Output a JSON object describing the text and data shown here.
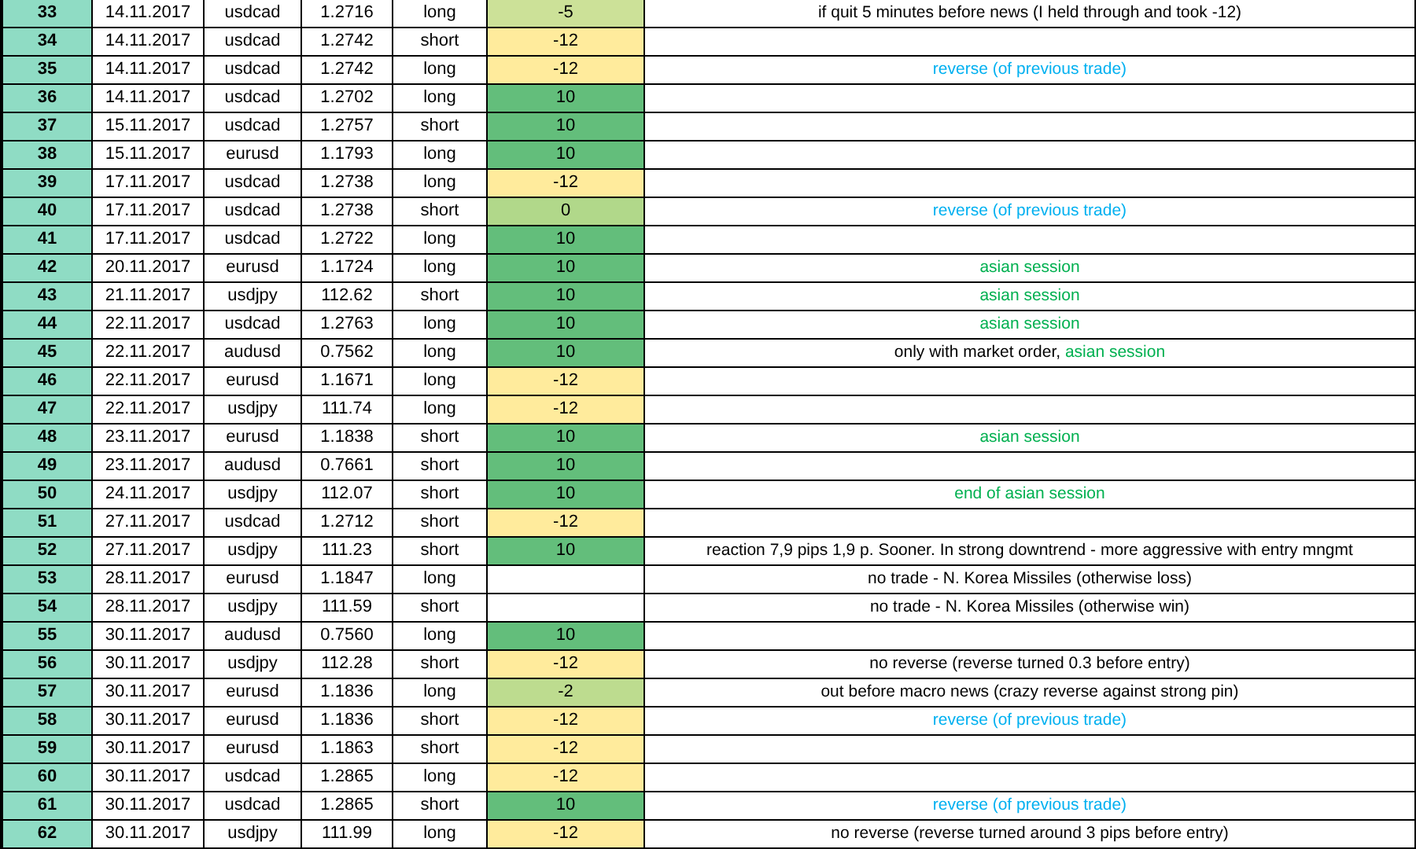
{
  "rows": [
    {
      "num": "33",
      "date": "14.11.2017",
      "pair": "usdcad",
      "price": "1.2716",
      "direction": "long",
      "result": {
        "text": "-5",
        "color": "#cce198"
      },
      "comment": [
        {
          "text": "if quit 5 minutes before news (I held through and took -12)",
          "color": "#000000"
        }
      ]
    },
    {
      "num": "34",
      "date": "14.11.2017",
      "pair": "usdcad",
      "price": "1.2742",
      "direction": "short",
      "result": {
        "text": "-12",
        "color": "#ffeb9c"
      }
    },
    {
      "num": "35",
      "date": "14.11.2017",
      "pair": "usdcad",
      "price": "1.2742",
      "direction": "long",
      "result": {
        "text": "-12",
        "color": "#ffeb9c"
      },
      "comment": [
        {
          "text": "reverse (of previous trade)",
          "color": "#00b0f0"
        }
      ]
    },
    {
      "num": "36",
      "date": "14.11.2017",
      "pair": "usdcad",
      "price": "1.2702",
      "direction": "long",
      "result": {
        "text": "10",
        "color": "#63be7b"
      }
    },
    {
      "num": "37",
      "date": "15.11.2017",
      "pair": "usdcad",
      "price": "1.2757",
      "direction": "short",
      "result": {
        "text": "10",
        "color": "#63be7b"
      }
    },
    {
      "num": "38",
      "date": "15.11.2017",
      "pair": "eurusd",
      "price": "1.1793",
      "direction": "long",
      "result": {
        "text": "10",
        "color": "#63be7b"
      }
    },
    {
      "num": "39",
      "date": "17.11.2017",
      "pair": "usdcad",
      "price": "1.2738",
      "direction": "long",
      "result": {
        "text": "-12",
        "color": "#ffeb9c"
      }
    },
    {
      "num": "40",
      "date": "17.11.2017",
      "pair": "usdcad",
      "price": "1.2738",
      "direction": "short",
      "result": {
        "text": "0",
        "color": "#b1d88a"
      },
      "comment": [
        {
          "text": "reverse (of previous trade)",
          "color": "#00b0f0"
        }
      ]
    },
    {
      "num": "41",
      "date": "17.11.2017",
      "pair": "usdcad",
      "price": "1.2722",
      "direction": "long",
      "result": {
        "text": "10",
        "color": "#63be7b"
      }
    },
    {
      "num": "42",
      "date": "20.11.2017",
      "pair": "eurusd",
      "price": "1.1724",
      "direction": "long",
      "result": {
        "text": "10",
        "color": "#63be7b"
      },
      "comment": [
        {
          "text": "asian session",
          "color": "#00b050"
        }
      ]
    },
    {
      "num": "43",
      "date": "21.11.2017",
      "pair": "usdjpy",
      "price": "112.62",
      "direction": "short",
      "result": {
        "text": "10",
        "color": "#63be7b"
      },
      "comment": [
        {
          "text": "asian session",
          "color": "#00b050"
        }
      ]
    },
    {
      "num": "44",
      "date": "22.11.2017",
      "pair": "usdcad",
      "price": "1.2763",
      "direction": "long",
      "result": {
        "text": "10",
        "color": "#63be7b"
      },
      "comment": [
        {
          "text": "asian session",
          "color": "#00b050"
        }
      ]
    },
    {
      "num": "45",
      "date": "22.11.2017",
      "pair": "audusd",
      "price": "0.7562",
      "direction": "long",
      "result": {
        "text": "10",
        "color": "#63be7b"
      },
      "comment": [
        {
          "text": "only with market order, ",
          "color": "#000000"
        },
        {
          "text": "asian session",
          "color": "#00b050"
        }
      ]
    },
    {
      "num": "46",
      "date": "22.11.2017",
      "pair": "eurusd",
      "price": "1.1671",
      "direction": "long",
      "result": {
        "text": "-12",
        "color": "#ffeb9c"
      }
    },
    {
      "num": "47",
      "date": "22.11.2017",
      "pair": "usdjpy",
      "price": "111.74",
      "direction": "long",
      "result": {
        "text": "-12",
        "color": "#ffeb9c"
      }
    },
    {
      "num": "48",
      "date": "23.11.2017",
      "pair": "eurusd",
      "price": "1.1838",
      "direction": "short",
      "result": {
        "text": "10",
        "color": "#63be7b"
      },
      "comment": [
        {
          "text": "asian session",
          "color": "#00b050"
        }
      ]
    },
    {
      "num": "49",
      "date": "23.11.2017",
      "pair": "audusd",
      "price": "0.7661",
      "direction": "short",
      "result": {
        "text": "10",
        "color": "#63be7b"
      }
    },
    {
      "num": "50",
      "date": "24.11.2017",
      "pair": "usdjpy",
      "price": "112.07",
      "direction": "short",
      "result": {
        "text": "10",
        "color": "#63be7b"
      },
      "comment": [
        {
          "text": "end of asian session",
          "color": "#00b050"
        }
      ]
    },
    {
      "num": "51",
      "date": "27.11.2017",
      "pair": "usdcad",
      "price": "1.2712",
      "direction": "short",
      "result": {
        "text": "-12",
        "color": "#ffeb9c"
      }
    },
    {
      "num": "52",
      "date": "27.11.2017",
      "pair": "usdjpy",
      "price": "111.23",
      "direction": "short",
      "result": {
        "text": "10",
        "color": "#63be7b"
      },
      "comment": [
        {
          "text": "reaction 7,9 pips 1,9 p. Sooner. In strong downtrend - more aggressive with entry mngmt",
          "color": "#000000"
        }
      ]
    },
    {
      "num": "53",
      "date": "28.11.2017",
      "pair": "eurusd",
      "price": "1.1847",
      "direction": "long",
      "comment": [
        {
          "text": "no trade - N. Korea Missiles (otherwise loss)",
          "color": "#000000"
        }
      ]
    },
    {
      "num": "54",
      "date": "28.11.2017",
      "pair": "usdjpy",
      "price": "111.59",
      "direction": "short",
      "comment": [
        {
          "text": "no trade - N. Korea Missiles (otherwise win)",
          "color": "#000000"
        }
      ]
    },
    {
      "num": "55",
      "date": "30.11.2017",
      "pair": "audusd",
      "price": "0.7560",
      "direction": "long",
      "result": {
        "text": "10",
        "color": "#63be7b"
      }
    },
    {
      "num": "56",
      "date": "30.11.2017",
      "pair": "usdjpy",
      "price": "112.28",
      "direction": "short",
      "result": {
        "text": "-12",
        "color": "#ffeb9c"
      },
      "comment": [
        {
          "text": "no reverse (reverse turned 0.3 before entry)",
          "color": "#000000"
        }
      ]
    },
    {
      "num": "57",
      "date": "30.11.2017",
      "pair": "eurusd",
      "price": "1.1836",
      "direction": "long",
      "result": {
        "text": "-2",
        "color": "#bddc8f"
      },
      "comment": [
        {
          "text": "out before macro news (crazy reverse against strong pin)",
          "color": "#000000"
        }
      ]
    },
    {
      "num": "58",
      "date": "30.11.2017",
      "pair": "eurusd",
      "price": "1.1836",
      "direction": "short",
      "result": {
        "text": "-12",
        "color": "#ffeb9c"
      },
      "comment": [
        {
          "text": "reverse (of previous trade)",
          "color": "#00b0f0"
        }
      ]
    },
    {
      "num": "59",
      "date": "30.11.2017",
      "pair": "eurusd",
      "price": "1.1863",
      "direction": "short",
      "result": {
        "text": "-12",
        "color": "#ffeb9c"
      }
    },
    {
      "num": "60",
      "date": "30.11.2017",
      "pair": "usdcad",
      "price": "1.2865",
      "direction": "long",
      "result": {
        "text": "-12",
        "color": "#ffeb9c"
      }
    },
    {
      "num": "61",
      "date": "30.11.2017",
      "pair": "usdcad",
      "price": "1.2865",
      "direction": "short",
      "result": {
        "text": "10",
        "color": "#63be7b"
      },
      "comment": [
        {
          "text": "reverse (of previous trade)",
          "color": "#00b0f0"
        }
      ]
    },
    {
      "num": "62",
      "date": "30.11.2017",
      "pair": "usdjpy",
      "price": "111.99",
      "direction": "long",
      "result": {
        "text": "-12",
        "color": "#ffeb9c"
      },
      "comment": [
        {
          "text": "no reverse (reverse turned around 3 pips before entry)",
          "color": "#000000"
        }
      ]
    }
  ]
}
